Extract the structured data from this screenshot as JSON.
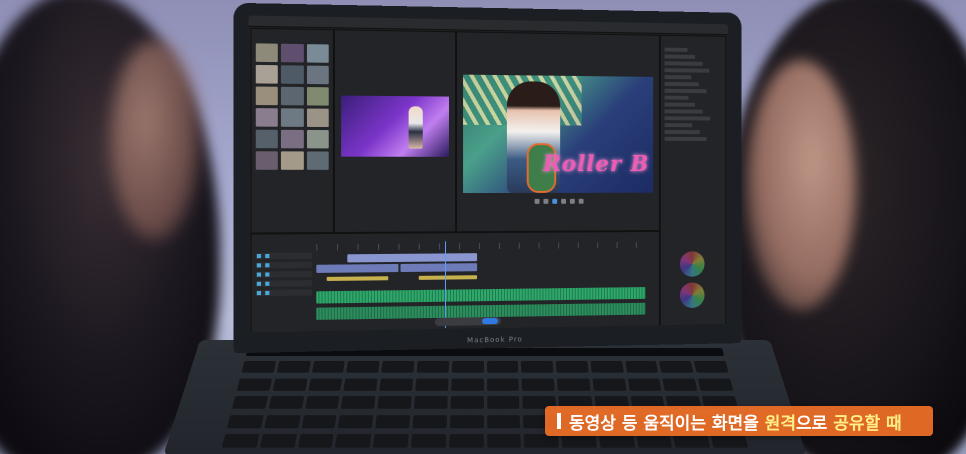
{
  "laptop": {
    "brand": "MacBook Pro"
  },
  "caption": {
    "part1": "동영상 등 움직이는 화면을 ",
    "highlight1": "원격",
    "part2": "으로 ",
    "highlight2": "공유할 때",
    "accent_color": "#f07026"
  },
  "editor": {
    "program_overlay_text": "Roller B"
  }
}
